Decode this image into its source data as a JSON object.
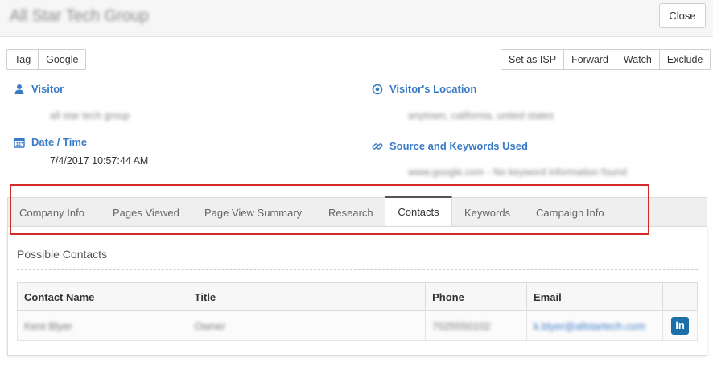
{
  "header": {
    "title": "All Star Tech Group",
    "close_label": "Close"
  },
  "left_actions": [
    "Tag",
    "Google"
  ],
  "right_actions": [
    "Set as ISP",
    "Forward",
    "Watch",
    "Exclude"
  ],
  "visitor": {
    "label": "Visitor",
    "value": "all star tech group"
  },
  "datetime": {
    "label": "Date / Time",
    "value": "7/4/2017 10:57:44 AM"
  },
  "location": {
    "label": "Visitor's Location",
    "value": "anytown, california, united states"
  },
  "source": {
    "label": "Source and Keywords Used",
    "value": "www.google.com - No keyword information found"
  },
  "tabs": {
    "items": [
      "Company Info",
      "Pages Viewed",
      "Page View Summary",
      "Research",
      "Contacts",
      "Keywords",
      "Campaign Info"
    ],
    "active": "Contacts"
  },
  "contacts_panel": {
    "title": "Possible Contacts",
    "columns": [
      "Contact Name",
      "Title",
      "Phone",
      "Email"
    ],
    "rows": [
      {
        "name": "Kent Blyer",
        "title": "Owner",
        "phone": "7025550102",
        "email": "k.blyer@allstartech.com",
        "linkedin": "in"
      }
    ]
  },
  "icons": {
    "visitor": "user-icon",
    "datetime": "calendar-icon",
    "location": "map-pin-icon",
    "source": "link-icon",
    "linkedin": "linkedin-icon"
  },
  "colors": {
    "accent": "#3a7bc8",
    "highlight_box": "#d42a2a",
    "linkedin": "#1b6fa8"
  }
}
